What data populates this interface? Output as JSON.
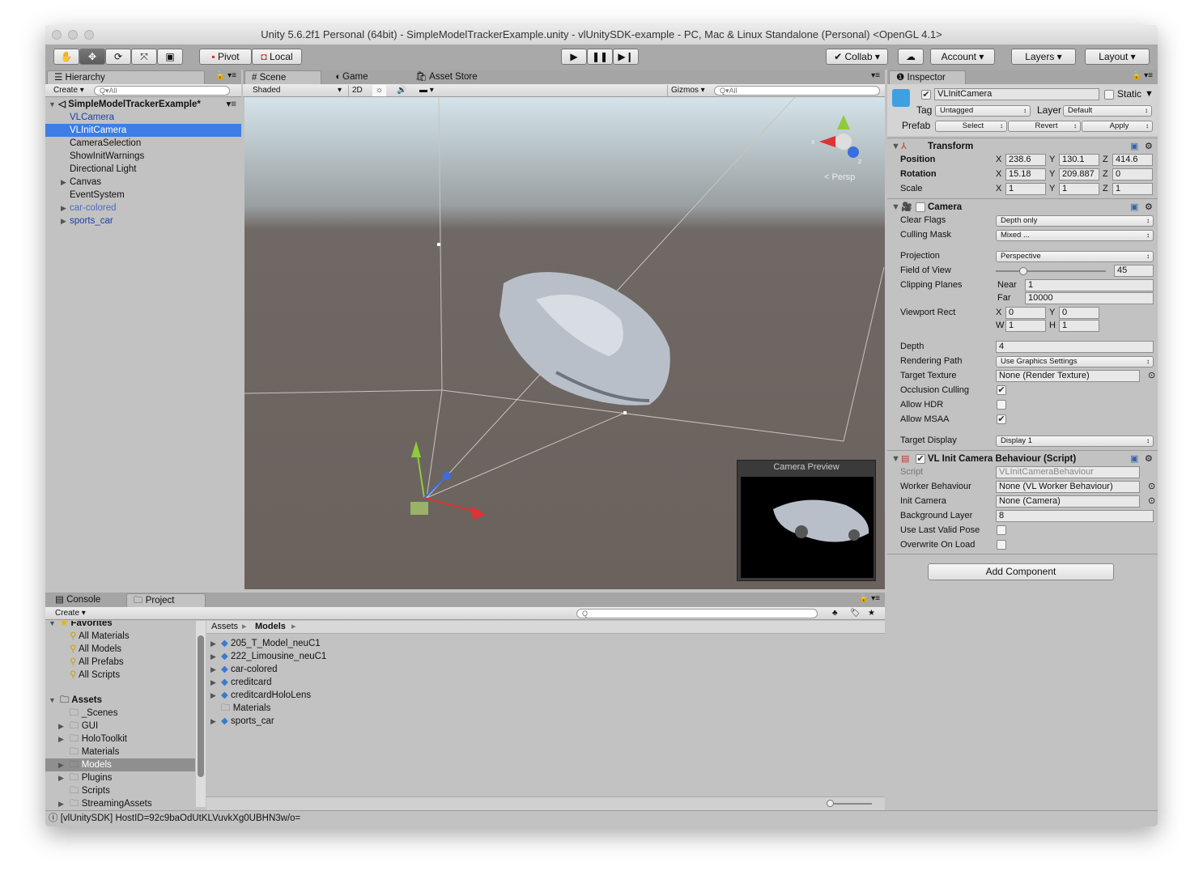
{
  "window": {
    "title": "Unity 5.6.2f1 Personal (64bit) - SimpleModelTrackerExample.unity - vlUnitySDK-example - PC, Mac & Linux Standalone (Personal) <OpenGL 4.1>"
  },
  "toolbar": {
    "pivot": "Pivot",
    "local": "Local",
    "collab": "Collab",
    "account": "Account",
    "layers": "Layers",
    "layout": "Layout",
    "tools": [
      "hand-icon",
      "move-icon",
      "rotate-icon",
      "scale-icon",
      "rect-icon"
    ]
  },
  "hierarchy": {
    "tab": "Hierarchy",
    "create": "Create",
    "search": "All",
    "scene": "SimpleModelTrackerExample*",
    "items": [
      {
        "label": "VLCamera",
        "blue": true
      },
      {
        "label": "VLInitCamera",
        "selected": true,
        "blue": true
      },
      {
        "label": "CameraSelection"
      },
      {
        "label": "ShowInitWarnings"
      },
      {
        "label": "Directional Light"
      },
      {
        "label": "Canvas",
        "expand": true
      },
      {
        "label": "EventSystem"
      },
      {
        "label": "car-colored",
        "expand": true,
        "faded": true
      },
      {
        "label": "sports_car",
        "expand": true,
        "blue": true
      }
    ]
  },
  "scene": {
    "tabs": {
      "scene": "Scene",
      "game": "Game",
      "store": "Asset Store"
    },
    "shading": "Shaded",
    "mode2d": "2D",
    "gizmos": "Gizmos",
    "search": "All",
    "persp": "Persp",
    "preview_title": "Camera Preview"
  },
  "inspector": {
    "tab": "Inspector",
    "name": "VLInitCamera",
    "static": "Static",
    "tag_label": "Tag",
    "tag": "Untagged",
    "layer_label": "Layer",
    "layer": "Default",
    "prefab_label": "Prefab",
    "select": "Select",
    "revert": "Revert",
    "apply": "Apply",
    "transform": {
      "title": "Transform",
      "position": {
        "label": "Position",
        "x": "238.6",
        "y": "130.1",
        "z": "414.6"
      },
      "rotation": {
        "label": "Rotation",
        "x": "15.18",
        "y": "209.887",
        "z": "0"
      },
      "scale": {
        "label": "Scale",
        "x": "1",
        "y": "1",
        "z": "1"
      }
    },
    "camera": {
      "title": "Camera",
      "clear_flags": [
        "Clear Flags",
        "Depth only"
      ],
      "culling_mask": [
        "Culling Mask",
        "Mixed ..."
      ],
      "projection": [
        "Projection",
        "Perspective"
      ],
      "fov": [
        "Field of View",
        "45"
      ],
      "fov_value": 45,
      "clipping": "Clipping Planes",
      "near": [
        "Near",
        "1"
      ],
      "far": [
        "Far",
        "10000"
      ],
      "viewport": "Viewport Rect",
      "vx": "0",
      "vy": "0",
      "vw": "1",
      "vh": "1",
      "depth": [
        "Depth",
        "4"
      ],
      "rendering_path": [
        "Rendering Path",
        "Use Graphics Settings"
      ],
      "target_texture": [
        "Target Texture",
        "None (Render Texture)"
      ],
      "occlusion": [
        "Occlusion Culling",
        true
      ],
      "hdr": [
        "Allow HDR",
        false
      ],
      "msaa": [
        "Allow MSAA",
        true
      ],
      "target_display": [
        "Target Display",
        "Display 1"
      ]
    },
    "script": {
      "title": "VL Init Camera Behaviour (Script)",
      "script": [
        "Script",
        "VLInitCameraBehaviour"
      ],
      "worker": [
        "Worker Behaviour",
        "None (VL Worker Behaviour)"
      ],
      "init_camera": [
        "Init Camera",
        "None (Camera)"
      ],
      "bg_layer": [
        "Background Layer",
        "8"
      ],
      "last_valid": [
        "Use Last Valid Pose",
        false
      ],
      "overwrite": [
        "Overwrite On Load",
        false
      ]
    },
    "add_component": "Add Component"
  },
  "bottom": {
    "console": "Console",
    "project": "Project",
    "create": "Create",
    "breadcrumb": [
      "Assets",
      "Models"
    ],
    "favorites": {
      "label": "Favorites",
      "items": [
        "All Materials",
        "All Models",
        "All Prefabs",
        "All Scripts"
      ]
    },
    "assets": {
      "label": "Assets",
      "items": [
        {
          "label": "_Scenes"
        },
        {
          "label": "GUI",
          "expand": true
        },
        {
          "label": "HoloToolkit",
          "expand": true
        },
        {
          "label": "Materials"
        },
        {
          "label": "Models",
          "expand": true,
          "selected": true
        },
        {
          "label": "Plugins",
          "expand": true
        },
        {
          "label": "Scripts"
        },
        {
          "label": "StreamingAssets",
          "expand": true
        }
      ]
    },
    "files": [
      {
        "label": "205_T_Model_neuC1",
        "expand": true,
        "model": true
      },
      {
        "label": "222_Limousine_neuC1",
        "expand": true,
        "model": true
      },
      {
        "label": "car-colored",
        "expand": true,
        "model": true
      },
      {
        "label": "creditcard",
        "expand": true,
        "model": true
      },
      {
        "label": "creditcardHoloLens",
        "expand": true,
        "model": true
      },
      {
        "label": "Materials"
      },
      {
        "label": "sports_car",
        "expand": true,
        "model": true
      }
    ]
  },
  "status": "[vlUnitySDK] HostID=92c9baOdUtKLVuvkXg0UBHN3w/o="
}
